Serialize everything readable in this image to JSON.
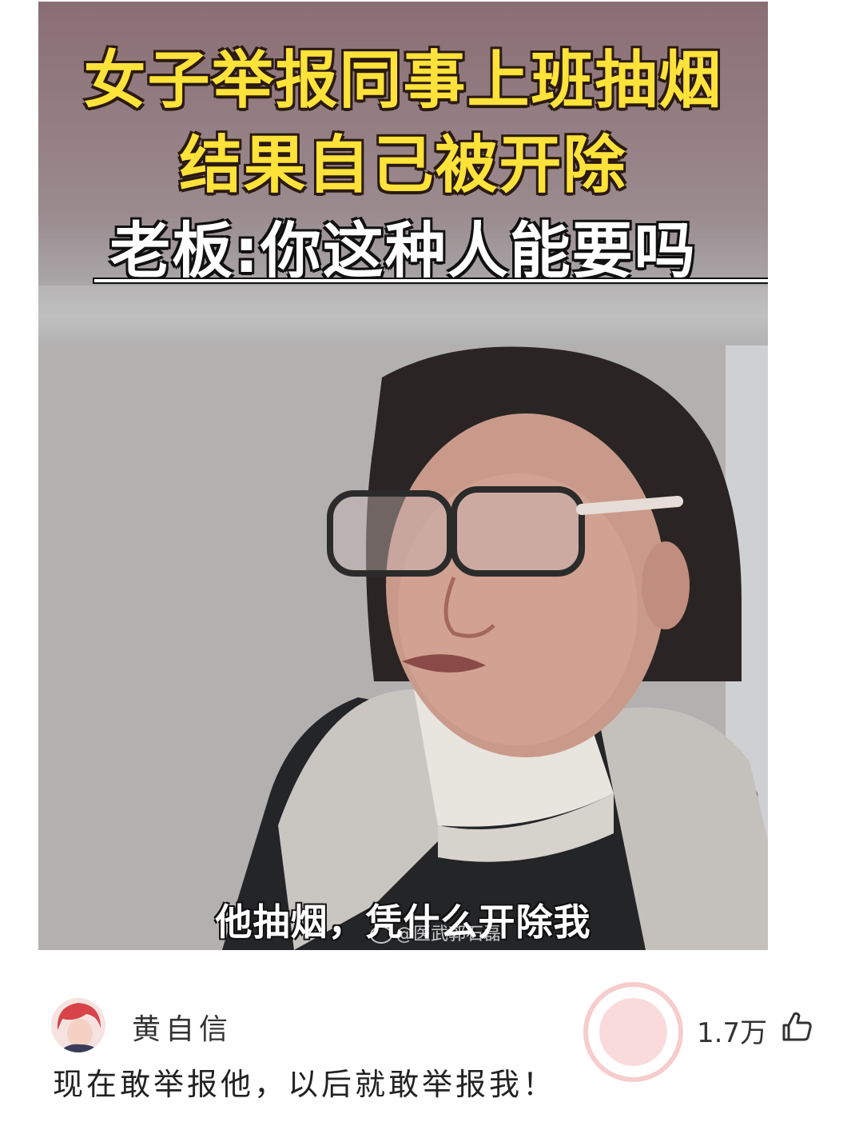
{
  "media": {
    "headline_line1": "女子举报同事上班抽烟",
    "headline_line2": "结果自己被开除",
    "headline_line3": "老板:你这种人能要吗",
    "subtitle": "他抽烟，凭什么开除我",
    "source_watermark": "@医武郭石磊"
  },
  "comment": {
    "username": "黄自信",
    "text": "现在敢举报他，以后就敢举报我！",
    "likes": "1.7万",
    "like_icon": "thumbs-up-icon"
  },
  "colors": {
    "headline_yellow": "#ffe23a",
    "headline_white": "#ffffff",
    "text_dark": "#222222"
  }
}
